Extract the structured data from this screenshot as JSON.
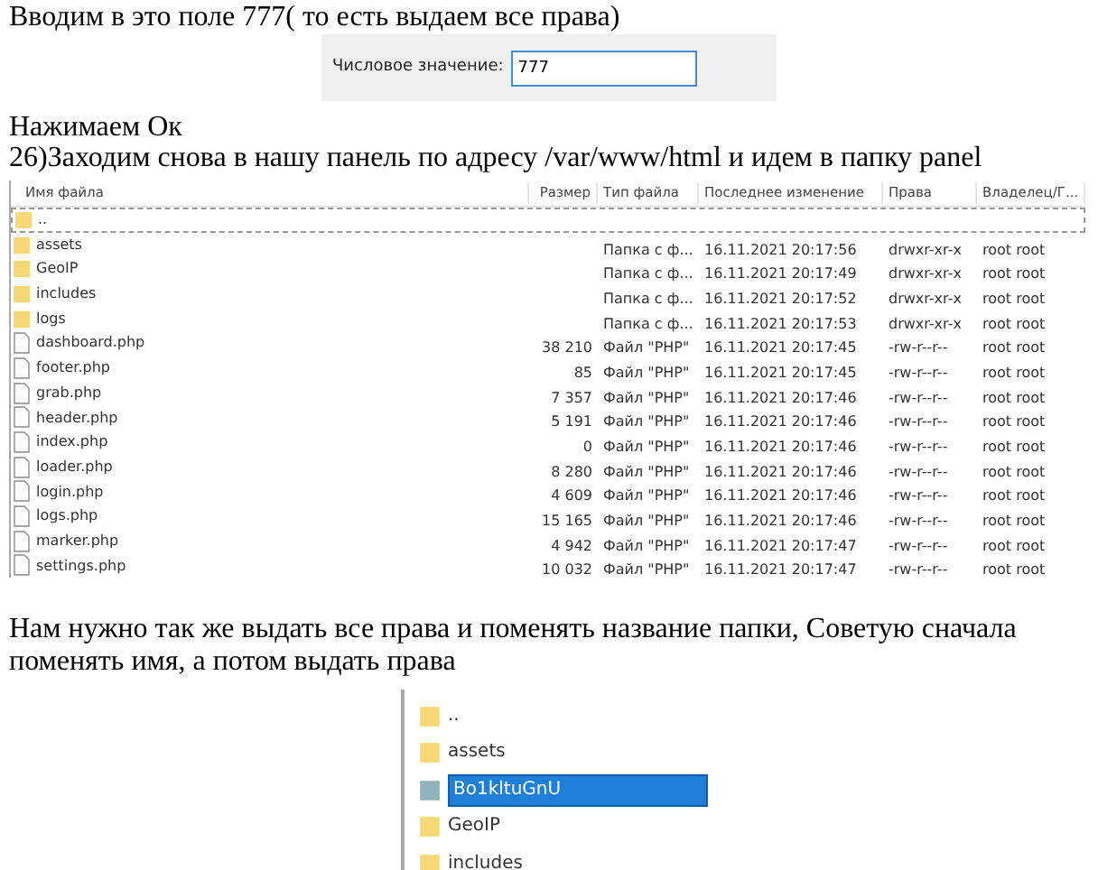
{
  "intro": "Вводим в это поле 777( то есть выдаем все права)",
  "numeric_field": {
    "label": "Числовое значение:",
    "value": "777"
  },
  "steps": [
    "Нажимаем Ок",
    "26)Заходим снова в нашу панель по адресу /var/www/html и идем в папку panel"
  ],
  "file_table": {
    "columns": [
      "Имя файла",
      "Размер",
      "Тип файла",
      "Последнее изменение",
      "Права",
      "Владелец/Г..."
    ],
    "rows": [
      {
        "kind": "folder",
        "name": "..",
        "size": "",
        "type": "",
        "modified": "",
        "rights": "",
        "owner": ""
      },
      {
        "kind": "folder",
        "name": "assets",
        "type": "Папка с ф...",
        "modified": "16.11.2021 20:17:56",
        "rights": "drwxr-xr-x",
        "owner": "root root"
      },
      {
        "kind": "folder",
        "name": "GeoIP",
        "type": "Папка с ф...",
        "modified": "16.11.2021 20:17:49",
        "rights": "drwxr-xr-x",
        "owner": "root root"
      },
      {
        "kind": "folder",
        "name": "includes",
        "type": "Папка с ф...",
        "modified": "16.11.2021 20:17:52",
        "rights": "drwxr-xr-x",
        "owner": "root root"
      },
      {
        "kind": "folder",
        "name": "logs",
        "type": "Папка с ф...",
        "modified": "16.11.2021 20:17:53",
        "rights": "drwxr-xr-x",
        "owner": "root root"
      },
      {
        "kind": "file",
        "name": "dashboard.php",
        "size": "38 210",
        "type": "Файл \"PHP\"",
        "modified": "16.11.2021 20:17:45",
        "rights": "-rw-r--r--",
        "owner": "root root"
      },
      {
        "kind": "file",
        "name": "footer.php",
        "size": "85",
        "type": "Файл \"PHP\"",
        "modified": "16.11.2021 20:17:45",
        "rights": "-rw-r--r--",
        "owner": "root root"
      },
      {
        "kind": "file",
        "name": "grab.php",
        "size": "7 357",
        "type": "Файл \"PHP\"",
        "modified": "16.11.2021 20:17:46",
        "rights": "-rw-r--r--",
        "owner": "root root"
      },
      {
        "kind": "file",
        "name": "header.php",
        "size": "5 191",
        "type": "Файл \"PHP\"",
        "modified": "16.11.2021 20:17:46",
        "rights": "-rw-r--r--",
        "owner": "root root"
      },
      {
        "kind": "file",
        "name": "index.php",
        "size": "0",
        "type": "Файл \"PHP\"",
        "modified": "16.11.2021 20:17:46",
        "rights": "-rw-r--r--",
        "owner": "root root"
      },
      {
        "kind": "file",
        "name": "loader.php",
        "size": "8 280",
        "type": "Файл \"PHP\"",
        "modified": "16.11.2021 20:17:46",
        "rights": "-rw-r--r--",
        "owner": "root root"
      },
      {
        "kind": "file",
        "name": "login.php",
        "size": "4 609",
        "type": "Файл \"PHP\"",
        "modified": "16.11.2021 20:17:46",
        "rights": "-rw-r--r--",
        "owner": "root root"
      },
      {
        "kind": "file",
        "name": "logs.php",
        "size": "15 165",
        "type": "Файл \"PHP\"",
        "modified": "16.11.2021 20:17:46",
        "rights": "-rw-r--r--",
        "owner": "root root"
      },
      {
        "kind": "file",
        "name": "marker.php",
        "size": "4 942",
        "type": "Файл \"PHP\"",
        "modified": "16.11.2021 20:17:47",
        "rights": "-rw-r--r--",
        "owner": "root root"
      },
      {
        "kind": "file",
        "name": "settings.php",
        "size": "10 032",
        "type": "Файл \"PHP\"",
        "modified": "16.11.2021 20:17:47",
        "rights": "-rw-r--r--",
        "owner": "root root"
      }
    ]
  },
  "advice": "Нам нужно так же выдать все права и поменять название папки, Советую сначала поменять имя, а потом выдать права",
  "rename_list": [
    {
      "name": "..",
      "selected": false
    },
    {
      "name": "assets",
      "selected": false
    },
    {
      "name": "Bo1kltuGnU",
      "selected": true
    },
    {
      "name": "GeoIP",
      "selected": false
    },
    {
      "name": "includes",
      "selected": false
    }
  ]
}
